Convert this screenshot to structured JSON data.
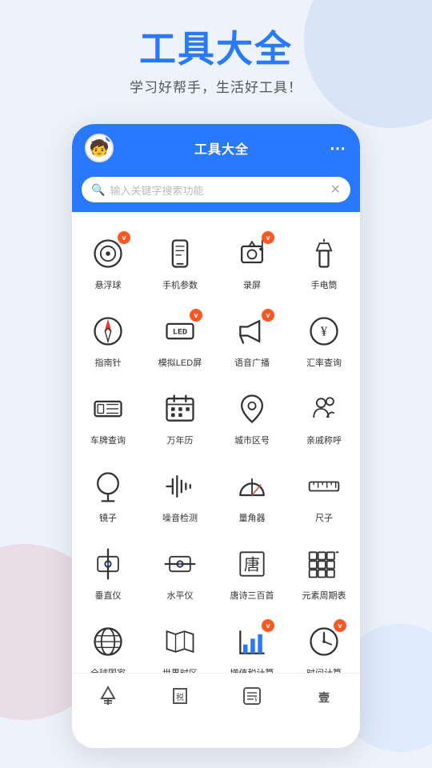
{
  "header": {
    "title": "工具大全",
    "subtitle": "学习好帮手，生活好工具！"
  },
  "phone": {
    "topbar_title": "工具大全",
    "more_icon": "···",
    "search_placeholder": "输入关键字搜索功能",
    "avatar_emoji": "🧒"
  },
  "grid_items": [
    {
      "id": "fuqiu",
      "label": "悬浮球",
      "badge": true,
      "icon_type": "circle_target"
    },
    {
      "id": "phone_params",
      "label": "手机参数",
      "badge": false,
      "icon_type": "phone"
    },
    {
      "id": "record_screen",
      "label": "录屏",
      "badge": true,
      "icon_type": "camera"
    },
    {
      "id": "flashlight",
      "label": "手电筒",
      "badge": false,
      "icon_type": "flashlight"
    },
    {
      "id": "compass",
      "label": "指南针",
      "badge": false,
      "icon_type": "compass"
    },
    {
      "id": "led",
      "label": "模拟LED屏",
      "badge": true,
      "icon_type": "led"
    },
    {
      "id": "voice_broadcast",
      "label": "语音广播",
      "badge": true,
      "icon_type": "megaphone"
    },
    {
      "id": "exchange_rate",
      "label": "汇率查询",
      "badge": false,
      "icon_type": "yen"
    },
    {
      "id": "plate_query",
      "label": "车牌查询",
      "badge": false,
      "icon_type": "plate"
    },
    {
      "id": "calendar",
      "label": "万年历",
      "badge": false,
      "icon_type": "calendar"
    },
    {
      "id": "area_code",
      "label": "城市区号",
      "badge": false,
      "icon_type": "location"
    },
    {
      "id": "relatives",
      "label": "亲戚称呼",
      "badge": false,
      "icon_type": "people"
    },
    {
      "id": "mirror",
      "label": "镜子",
      "badge": false,
      "icon_type": "mirror"
    },
    {
      "id": "noise_detect",
      "label": "噪音检测",
      "badge": false,
      "icon_type": "noise"
    },
    {
      "id": "protractor",
      "label": "量角器",
      "badge": false,
      "icon_type": "protractor"
    },
    {
      "id": "ruler",
      "label": "尺子",
      "badge": false,
      "icon_type": "ruler"
    },
    {
      "id": "level_vertical",
      "label": "垂直仪",
      "badge": false,
      "icon_type": "vertical"
    },
    {
      "id": "level_horizontal",
      "label": "水平仪",
      "badge": false,
      "icon_type": "horizontal"
    },
    {
      "id": "tang_poetry",
      "label": "唐诗三百首",
      "badge": false,
      "icon_type": "poetry"
    },
    {
      "id": "periodic_table",
      "label": "元素周期表",
      "badge": false,
      "icon_type": "periodic"
    },
    {
      "id": "world_countries",
      "label": "全球国家",
      "badge": false,
      "icon_type": "globe"
    },
    {
      "id": "world_time",
      "label": "世界时区",
      "badge": false,
      "icon_type": "map"
    },
    {
      "id": "tax_calc",
      "label": "增值税计算",
      "badge": true,
      "icon_type": "tax_chart"
    },
    {
      "id": "time_calc",
      "label": "时间计算",
      "badge": true,
      "icon_type": "clock"
    }
  ],
  "bottom_nav": [
    {
      "id": "nav_yen",
      "icon": "¥",
      "label": ""
    },
    {
      "id": "nav_tax",
      "icon": "税",
      "label": ""
    },
    {
      "id": "nav_doc",
      "icon": "≡¥",
      "label": ""
    },
    {
      "id": "nav_one",
      "icon": "壹",
      "label": ""
    }
  ],
  "colors": {
    "primary": "#2979ff",
    "badge": "#ff5722",
    "text_dark": "#333",
    "text_light": "#bbb",
    "bg": "#eef3fb"
  }
}
